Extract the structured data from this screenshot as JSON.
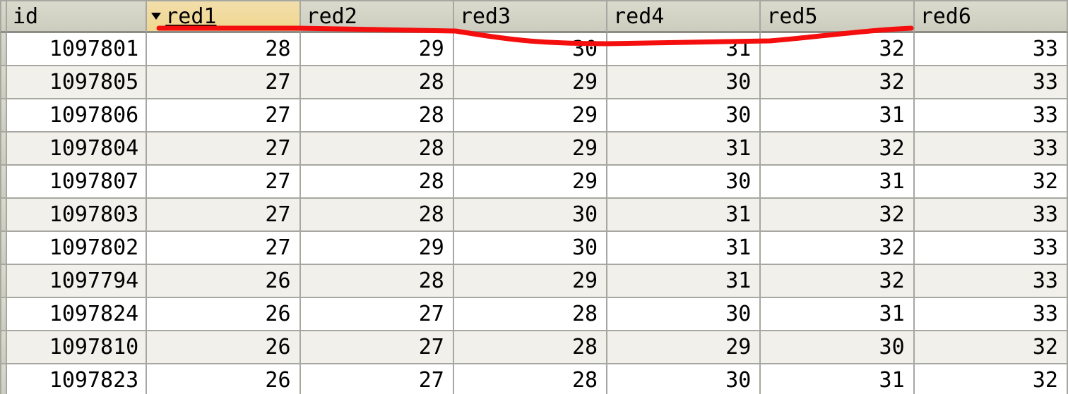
{
  "columns": {
    "id": {
      "label": "id",
      "sorted": false
    },
    "red1": {
      "label": "red1",
      "sorted": true
    },
    "red2": {
      "label": "red2",
      "sorted": false
    },
    "red3": {
      "label": "red3",
      "sorted": false
    },
    "red4": {
      "label": "red4",
      "sorted": false
    },
    "red5": {
      "label": "red5",
      "sorted": false
    },
    "red6": {
      "label": "red6",
      "sorted": false
    }
  },
  "rows": [
    {
      "id": "1097801",
      "red1": "28",
      "red2": "29",
      "red3": "30",
      "red4": "31",
      "red5": "32",
      "red6": "33"
    },
    {
      "id": "1097805",
      "red1": "27",
      "red2": "28",
      "red3": "29",
      "red4": "30",
      "red5": "32",
      "red6": "33"
    },
    {
      "id": "1097806",
      "red1": "27",
      "red2": "28",
      "red3": "29",
      "red4": "30",
      "red5": "31",
      "red6": "33"
    },
    {
      "id": "1097804",
      "red1": "27",
      "red2": "28",
      "red3": "29",
      "red4": "31",
      "red5": "32",
      "red6": "33"
    },
    {
      "id": "1097807",
      "red1": "27",
      "red2": "28",
      "red3": "29",
      "red4": "30",
      "red5": "31",
      "red6": "32"
    },
    {
      "id": "1097803",
      "red1": "27",
      "red2": "28",
      "red3": "30",
      "red4": "31",
      "red5": "32",
      "red6": "33"
    },
    {
      "id": "1097802",
      "red1": "27",
      "red2": "29",
      "red3": "30",
      "red4": "31",
      "red5": "32",
      "red6": "33"
    },
    {
      "id": "1097794",
      "red1": "26",
      "red2": "28",
      "red3": "29",
      "red4": "31",
      "red5": "32",
      "red6": "33"
    },
    {
      "id": "1097824",
      "red1": "26",
      "red2": "27",
      "red3": "28",
      "red4": "30",
      "red5": "31",
      "red6": "33"
    },
    {
      "id": "1097810",
      "red1": "26",
      "red2": "27",
      "red3": "28",
      "red4": "29",
      "red5": "30",
      "red6": "32"
    },
    {
      "id": "1097823",
      "red1": "26",
      "red2": "27",
      "red3": "28",
      "red4": "30",
      "red5": "31",
      "red6": "32"
    }
  ],
  "annotation": {
    "color": "#f40e0e"
  }
}
